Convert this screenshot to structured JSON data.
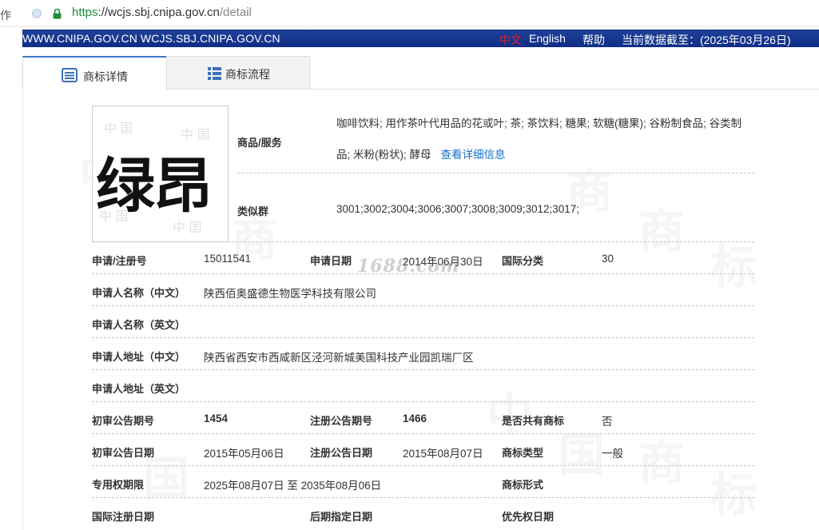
{
  "browser": {
    "nav_label": "作",
    "url_proto": "https",
    "url_host": "://wcjs.sbj.cnipa.gov.cn",
    "url_path": "/detail"
  },
  "topbar": {
    "sites": "WWW.CNIPA.GOV.CN WCJS.SBJ.CNIPA.GOV.CN",
    "lang_cn": "中文",
    "lang_en": "English",
    "help": "帮助",
    "data_date": "当前数据截至：(2025年03月26日)"
  },
  "tabs": [
    {
      "label": "商标详情",
      "active": true,
      "icon": "list-detail-icon"
    },
    {
      "label": "商标流程",
      "active": false,
      "icon": "grid-list-icon"
    }
  ],
  "trademark": {
    "mark_text": "绿昂",
    "goods_label": "商品/服务",
    "goods_value": "咖啡饮料; 用作茶叶代用品的花或叶; 茶; 茶饮料; 糖果; 软糖(糖果); 谷粉制食品; 谷类制品; 米粉(粉状); 酵母",
    "goods_link": "查看详细信息",
    "similar_label": "类似群",
    "similar_value": "3001;3002;3004;3006;3007;3008;3009;3012;3017;"
  },
  "details": {
    "reg_no_label": "申请/注册号",
    "reg_no": "15011541",
    "apply_date_label": "申请日期",
    "apply_date": "2014年06月30日",
    "intl_class_label": "国际分类",
    "intl_class": "30",
    "applicant_cn_label": "申请人名称（中文）",
    "applicant_cn": "陕西佰奥盛德生物医学科技有限公司",
    "applicant_en_label": "申请人名称（英文）",
    "address_cn_label": "申请人地址（中文）",
    "address_cn": "陕西省西安市西咸新区泾河新城美国科技产业园凯瑞厂区",
    "address_en_label": "申请人地址（英文）",
    "prelim_no_label": "初审公告期号",
    "prelim_no": "1454",
    "reg_pub_no_label": "注册公告期号",
    "reg_pub_no": "1466",
    "shared_label": "是否共有商标",
    "shared": "否",
    "prelim_date_label": "初审公告日期",
    "prelim_date": "2015年05月06日",
    "reg_pub_date_label": "注册公告日期",
    "reg_pub_date": "2015年08月07日",
    "type_label": "商标类型",
    "type": "一般",
    "term_label": "专用权期限",
    "term": "2025年08月07日 至 2035年08月06日",
    "form_label": "商标形式",
    "intl_reg_label": "国际注册日期",
    "late_label": "后期指定日期",
    "priority_label": "优先权日期"
  },
  "watermarks": {
    "site": "1688.com",
    "cn": "中",
    "guo": "国",
    "shang": "商",
    "biao": "标"
  }
}
